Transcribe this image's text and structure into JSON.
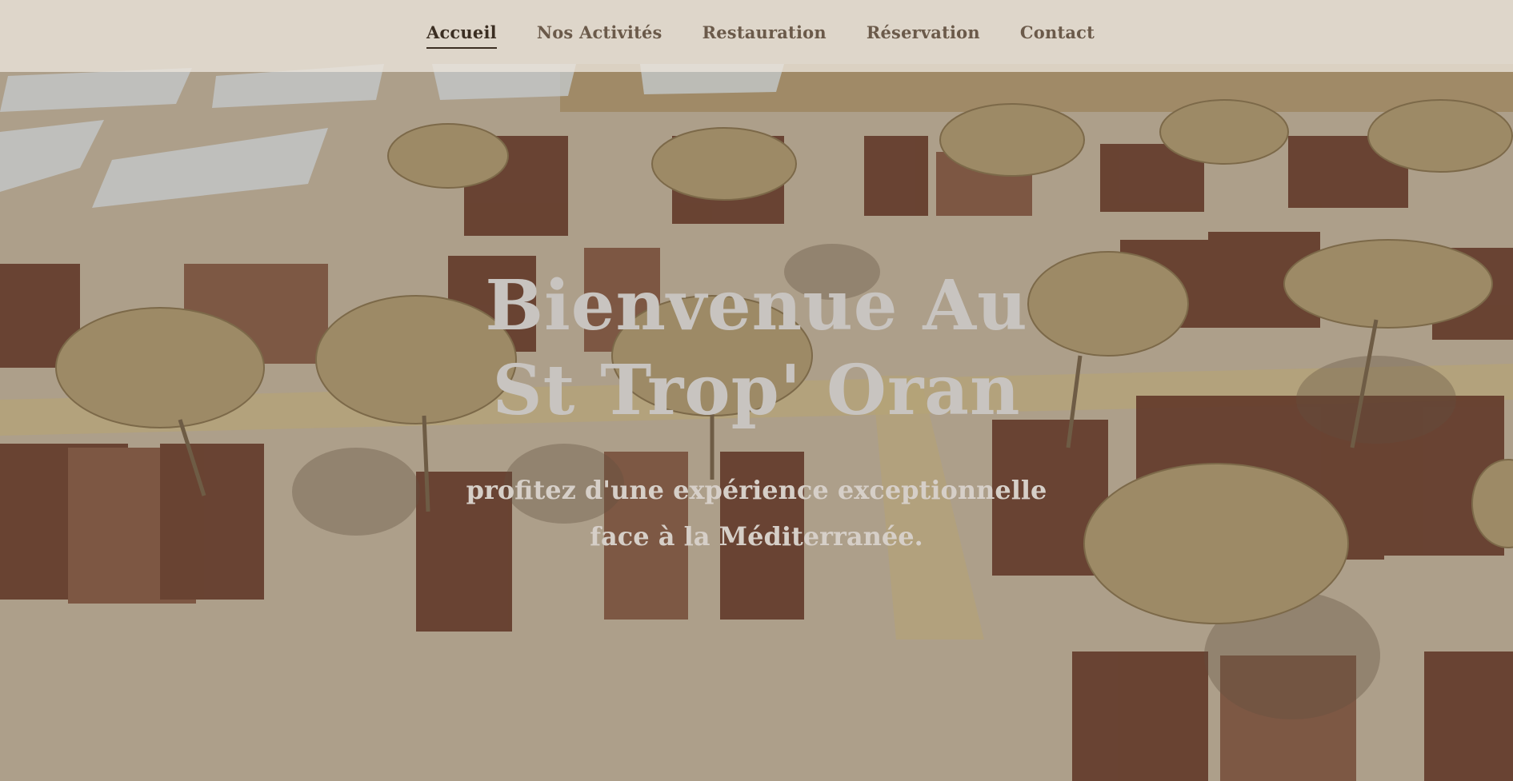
{
  "nav": {
    "items": [
      {
        "label": "Accueil",
        "active": true
      },
      {
        "label": "Nos Activités",
        "active": false
      },
      {
        "label": "Restauration",
        "active": false
      },
      {
        "label": "Réservation",
        "active": false
      },
      {
        "label": "Contact",
        "active": false
      }
    ]
  },
  "hero": {
    "title": "Bienvenue Au St Trop' Oran",
    "subtitle": "profitez d'une expérience exceptionnelle face à la Méditerranée."
  },
  "colors": {
    "nav_bg": "#ece6dc",
    "nav_text": "#6b5a4a",
    "nav_active": "#3b2e22",
    "title_text": "#c8c4c0",
    "sand": "#cbbca6",
    "lounger": "#6e3d2c",
    "parasol": "#b9a57a"
  }
}
